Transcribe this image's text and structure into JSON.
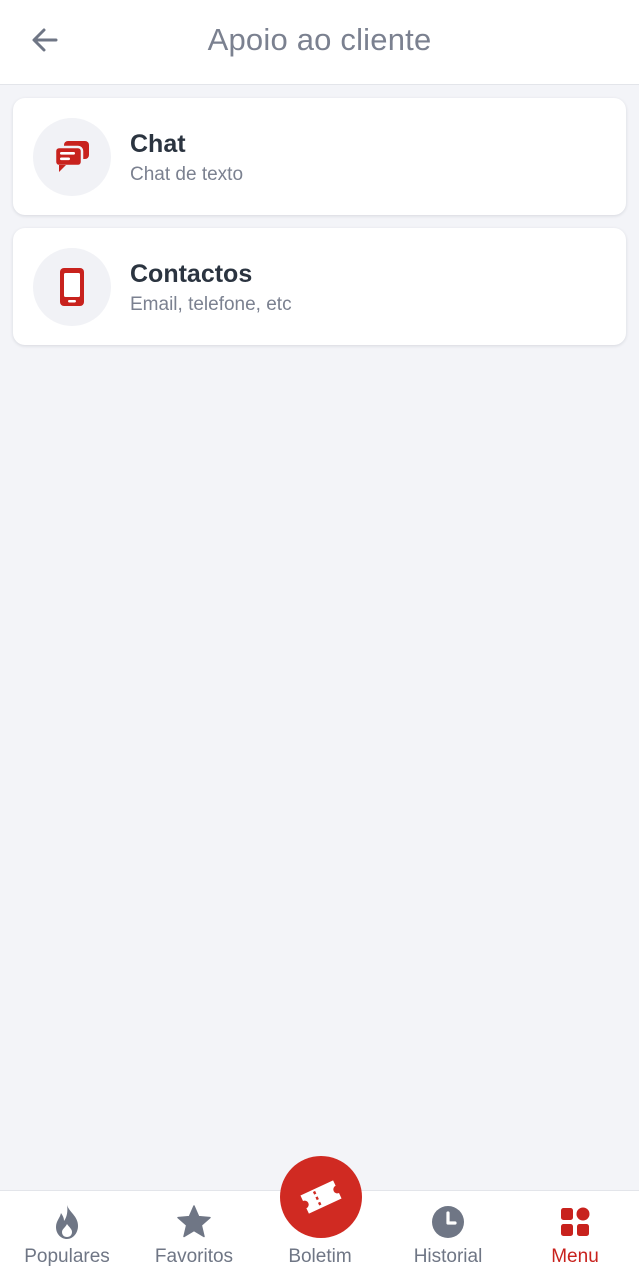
{
  "header": {
    "title": "Apoio ao cliente",
    "back_icon": "arrow-left-icon"
  },
  "options": [
    {
      "title": "Chat",
      "subtitle": "Chat de texto",
      "icon": "chat-bubbles-icon"
    },
    {
      "title": "Contactos",
      "subtitle": "Email, telefone, etc",
      "icon": "smartphone-icon"
    }
  ],
  "tabbar": {
    "tabs": [
      {
        "label": "Populares",
        "icon": "flame-icon",
        "active": false
      },
      {
        "label": "Favoritos",
        "icon": "star-icon",
        "active": false
      },
      {
        "label": "Boletim",
        "icon": "ticket-icon",
        "active": false
      },
      {
        "label": "Historial",
        "icon": "clock-icon",
        "active": false
      },
      {
        "label": "Menu",
        "icon": "grid-icon",
        "active": true
      }
    ]
  },
  "colors": {
    "accent": "#c8221d",
    "background": "#f3f4f8",
    "text_primary": "#2b3440",
    "text_muted": "#7b8190"
  }
}
